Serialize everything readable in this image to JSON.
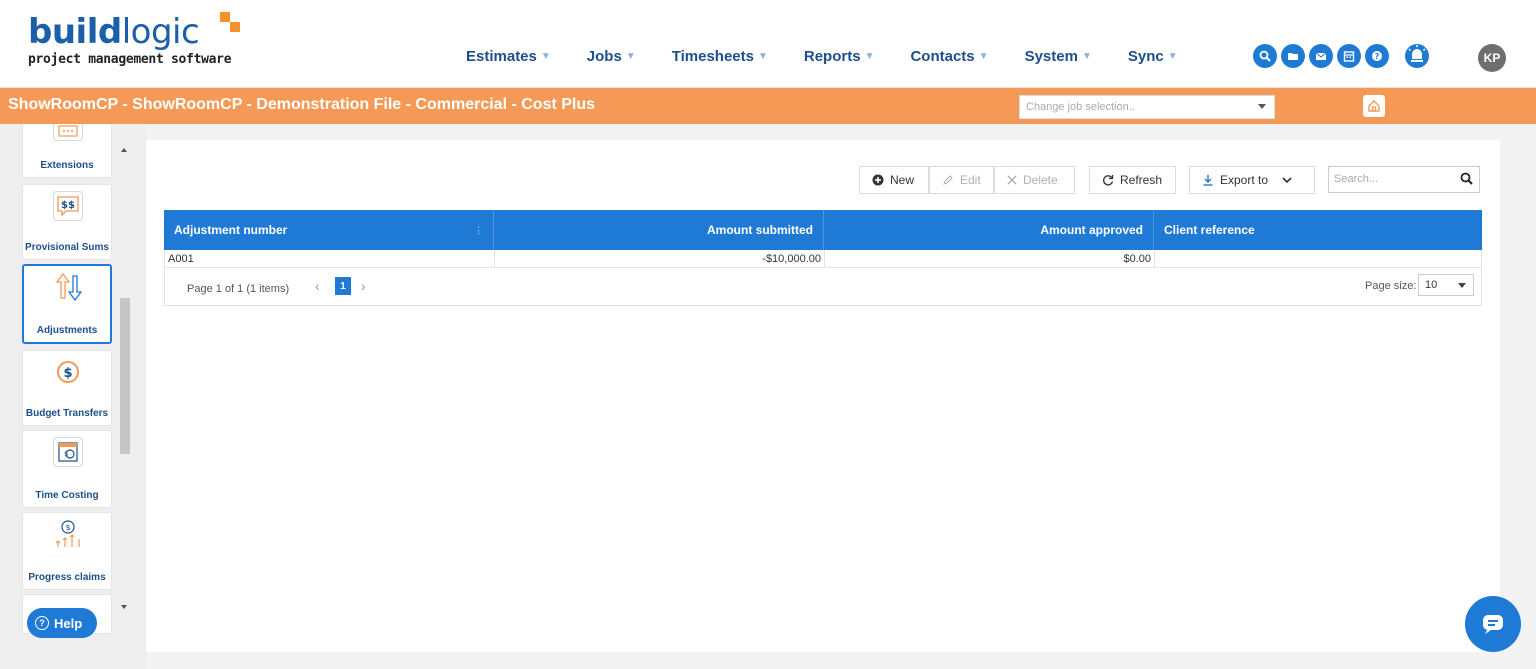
{
  "brand": {
    "name_bold": "build",
    "name_light": "logic",
    "tagline": "project management software",
    "accent": "#f5922a",
    "primary": "#1f7ad6"
  },
  "nav": {
    "items": [
      {
        "label": "Estimates"
      },
      {
        "label": "Jobs"
      },
      {
        "label": "Timesheets"
      },
      {
        "label": "Reports"
      },
      {
        "label": "Contacts"
      },
      {
        "label": "System"
      },
      {
        "label": "Sync"
      }
    ]
  },
  "header_tools": [
    "search-icon",
    "folder-icon",
    "mail-icon",
    "calendar-icon",
    "help-icon",
    "alert-icon"
  ],
  "user": {
    "initials": "KP"
  },
  "job": {
    "title": "ShowRoomCP - ShowRoomCP - Demonstration File - Commercial - Cost Plus",
    "select_placeholder": "Change job selection.."
  },
  "sidebar": {
    "items": [
      {
        "label": "Extensions"
      },
      {
        "label": "Provisional Sums"
      },
      {
        "label": "Adjustments"
      },
      {
        "label": "Budget Transfers"
      },
      {
        "label": "Time Costing"
      },
      {
        "label": "Progress claims"
      }
    ],
    "help_label": "Help"
  },
  "toolbar": {
    "new_label": "New",
    "edit_label": "Edit",
    "delete_label": "Delete",
    "refresh_label": "Refresh",
    "export_label": "Export to",
    "search_placeholder": "Search..."
  },
  "grid": {
    "columns": [
      "Adjustment number",
      "Amount submitted",
      "Amount approved",
      "Client reference"
    ],
    "rows": [
      {
        "adjustment_number": "A001",
        "amount_submitted": "-$10,000.00",
        "amount_approved": "$0.00",
        "client_reference": ""
      }
    ],
    "pager": {
      "info": "Page 1 of 1 (1 items)",
      "current_page": "1",
      "page_size_label": "Page size:",
      "page_size": "10"
    }
  }
}
